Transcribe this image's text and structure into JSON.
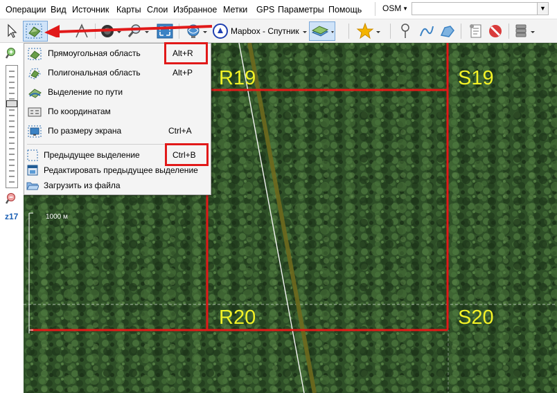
{
  "menubar": {
    "items": [
      "Операции",
      "Вид",
      "Источник",
      "Карты",
      "Слои",
      "Избранное",
      "Метки",
      "GPS",
      "Параметры",
      "Помощь"
    ],
    "map_source": "OSM",
    "search_value": ""
  },
  "toolbar": {
    "map_type_label": "Mapbox - Спутник"
  },
  "dropdown": {
    "items": [
      {
        "label": "Прямоугольная область",
        "shortcut": "Alt+R",
        "icon": "rect-selection-icon"
      },
      {
        "label": "Полигональная область",
        "shortcut": "Alt+P",
        "icon": "polygon-selection-icon"
      },
      {
        "label": "Выделение по пути",
        "shortcut": "",
        "icon": "path-selection-icon"
      },
      {
        "label": "По координатам",
        "shortcut": "",
        "icon": "coordinates-icon"
      },
      {
        "label": "По размеру экрана",
        "shortcut": "Ctrl+A",
        "icon": "screen-size-icon"
      },
      {
        "label": "Предыдущее выделение",
        "shortcut": "Ctrl+B",
        "icon": "previous-selection-icon"
      },
      {
        "label": "Редактировать предыдущее выделение",
        "shortcut": "",
        "icon": "edit-selection-icon"
      },
      {
        "label": "Загрузить из файла",
        "shortcut": "",
        "icon": "folder-icon"
      }
    ]
  },
  "left_panel": {
    "zoom_level": "z17"
  },
  "map": {
    "scale_label": "1000 м",
    "grid_labels": [
      "R19",
      "S19",
      "R20",
      "S20"
    ],
    "colors": {
      "grid": "#e11919",
      "label": "#f2f227",
      "annotation": "#e11919"
    }
  }
}
